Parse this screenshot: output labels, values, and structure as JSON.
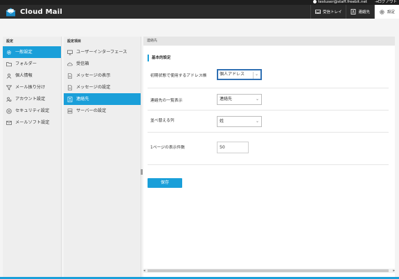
{
  "topbar": {
    "user_email": "testuser@staff.freebit.net",
    "logout_label": "ログアウト"
  },
  "header": {
    "app_name": "Cloud Mail",
    "nav": [
      {
        "label": "受信トレイ",
        "icon": "inbox-icon"
      },
      {
        "label": "連絡先",
        "icon": "contacts-icon"
      },
      {
        "label": "設定",
        "icon": "gear-icon"
      }
    ]
  },
  "col1": {
    "heading": "設定",
    "items": [
      {
        "label": "一般設定",
        "icon": "gear-icon",
        "active": true
      },
      {
        "label": "フォルダー",
        "icon": "folder-icon"
      },
      {
        "label": "個人情報",
        "icon": "user-icon"
      },
      {
        "label": "メール振り分け",
        "icon": "filter-icon"
      },
      {
        "label": "アカウント設定",
        "icon": "account-icon"
      },
      {
        "label": "セキュリティ設定",
        "icon": "security-icon"
      },
      {
        "label": "メールソフト設定",
        "icon": "mail-client-icon"
      }
    ]
  },
  "col2": {
    "heading": "設定項目",
    "items": [
      {
        "label": "ユーザーインターフェース",
        "icon": "monitor-icon"
      },
      {
        "label": "受信箱",
        "icon": "cloud-icon"
      },
      {
        "label": "メッセージの表示",
        "icon": "message-view-icon"
      },
      {
        "label": "メッセージの設定",
        "icon": "message-settings-icon"
      },
      {
        "label": "連絡先",
        "icon": "contact-book-icon",
        "active": true
      },
      {
        "label": "サーバーの設定",
        "icon": "server-icon"
      }
    ]
  },
  "content": {
    "bar_title": "連絡先",
    "section_title": "基本的設定",
    "rows": [
      {
        "label": "初期状態で使用するアドレス帳",
        "value": "個人アドレス"
      },
      {
        "label": "連絡先の一覧表示",
        "value": "連絡先"
      },
      {
        "label": "並べ替える列",
        "value": "姓"
      },
      {
        "label": "1ページの表示件数",
        "value": "50"
      }
    ],
    "save_label": "保存"
  },
  "colors": {
    "accent": "#1a9fd9",
    "header_bg": "#2b2b2b",
    "topstrip_bg": "#1e1e1e"
  }
}
